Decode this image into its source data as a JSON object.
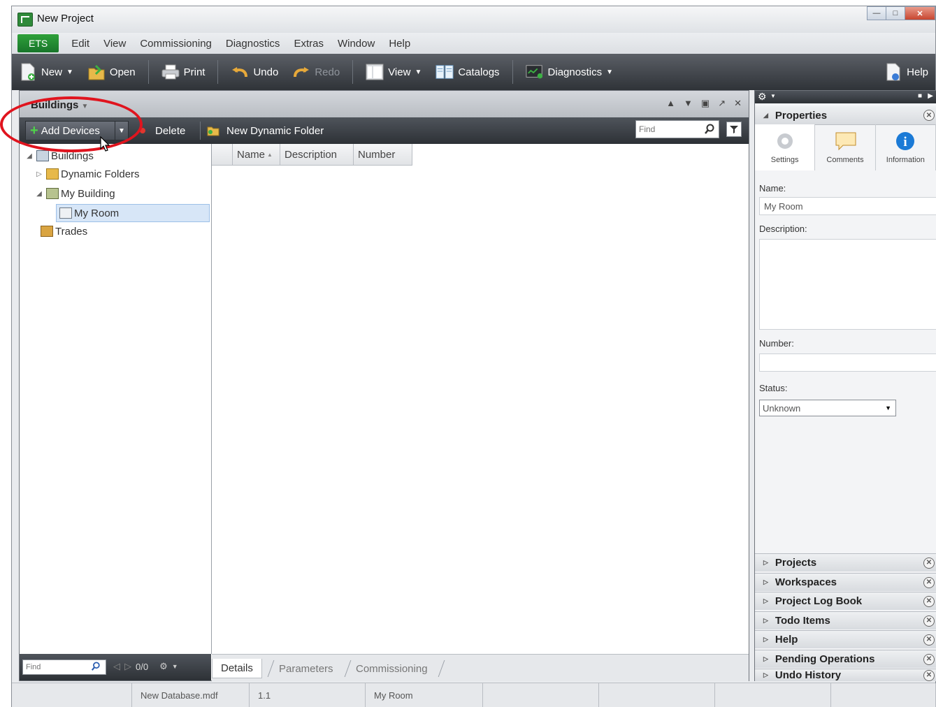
{
  "window": {
    "title": "New Project"
  },
  "menu": {
    "ets": "ETS",
    "items": [
      "Edit",
      "View",
      "Commissioning",
      "Diagnostics",
      "Extras",
      "Window",
      "Help"
    ]
  },
  "toolbar": {
    "new": "New",
    "open": "Open",
    "print": "Print",
    "undo": "Undo",
    "redo": "Redo",
    "view": "View",
    "catalogs": "Catalogs",
    "diagnostics": "Diagnostics",
    "help": "Help"
  },
  "buildings_panel": {
    "title": "Buildings",
    "add_devices": "Add Devices",
    "delete": "Delete",
    "new_dynamic_folder": "New Dynamic Folder",
    "find_placeholder": "Find",
    "tree": {
      "root": "Buildings",
      "dynamic_folders": "Dynamic Folders",
      "my_building": "My Building",
      "my_room": "My Room",
      "trades": "Trades"
    },
    "columns": [
      "Name",
      "Description",
      "Number"
    ],
    "footer_find_placeholder": "Find",
    "pager": "0/0",
    "tabs": [
      "Details",
      "Parameters",
      "Commissioning"
    ]
  },
  "properties": {
    "title": "Properties",
    "tabs": [
      "Settings",
      "Comments",
      "Information"
    ],
    "name_label": "Name:",
    "name_value": "My Room",
    "description_label": "Description:",
    "description_value": "",
    "number_label": "Number:",
    "number_value": "",
    "status_label": "Status:",
    "status_value": "Unknown"
  },
  "side_sections": [
    "Projects",
    "Workspaces",
    "Project Log Book",
    "Todo Items",
    "Help",
    "Pending Operations",
    "Undo History"
  ],
  "statusbar": {
    "database": "New Database.mdf",
    "version": "1.1",
    "location": "My Room"
  },
  "colors": {
    "ets_green": "#18752a",
    "annotation_red": "#e0141e",
    "selection": "#d7e6f7"
  }
}
